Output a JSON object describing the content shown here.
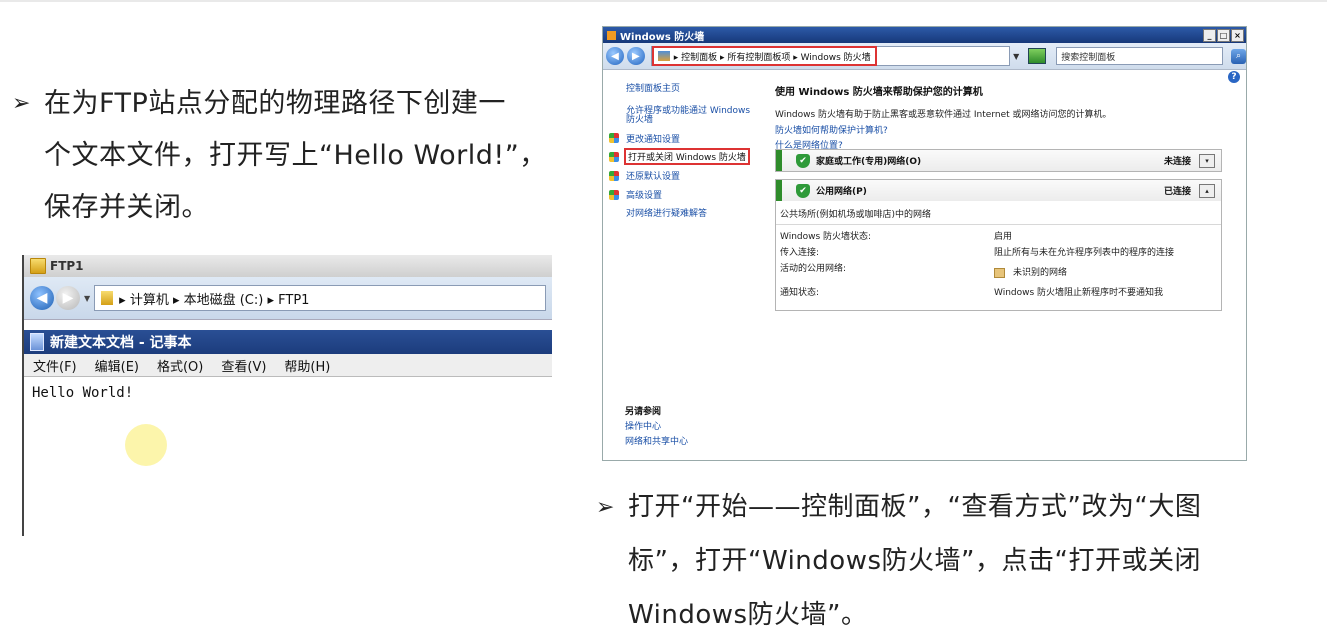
{
  "left_instruction": {
    "bullet": "➢",
    "line1": "在为FTP站点分配的物理路径下创建一",
    "line2": "个文本文件，打开写上“Hello World!”，",
    "line3": "保存并关闭。"
  },
  "explorer": {
    "title": "FTP1",
    "breadcrumb": "▸ 计算机 ▸ 本地磁盘 (C:) ▸ FTP1"
  },
  "notepad": {
    "title": "新建文本文档 - 记事本",
    "menu": [
      "文件(F)",
      "编辑(E)",
      "格式(O)",
      "查看(V)",
      "帮助(H)"
    ],
    "content": "Hello World!"
  },
  "firewall": {
    "window_title": "Windows 防火墙",
    "window_buttons": [
      "_",
      "□",
      "×"
    ],
    "address_path": "▸ 控制面板 ▸ 所有控制面板项 ▸ Windows 防火墙",
    "search_placeholder": "搜索控制面板",
    "left_nav": {
      "home": "控制面板主页",
      "allow_programs": "允许程序或功能通过 Windows 防火墙",
      "change_notify": "更改通知设置",
      "toggle_firewall": "打开或关闭 Windows 防火墙",
      "restore_defaults": "还原默认设置",
      "advanced": "高级设置",
      "troubleshoot": "对网络进行疑难解答"
    },
    "see_also": {
      "heading": "另请参阅",
      "action_center": "操作中心",
      "network_center": "网络和共享中心"
    },
    "main": {
      "title": "使用 Windows 防火墙来帮助保护您的计算机",
      "desc": "Windows 防火墙有助于防止黑客或恶意软件通过 Internet 或网络访问您的计算机。",
      "link1": "防火墙如何帮助保护计算机?",
      "link2": "什么是网络位置?"
    },
    "networks": [
      {
        "name": "家庭或工作(专用)网络(O)",
        "status": "未连接",
        "toggle": "▾"
      },
      {
        "name": "公用网络(P)",
        "status": "已连接",
        "toggle": "▴",
        "desc": "公共场所(例如机场或咖啡店)中的网络",
        "rows": [
          {
            "k": "Windows 防火墙状态:",
            "v": "启用"
          },
          {
            "k": "传入连接:",
            "v": "阻止所有与未在允许程序列表中的程序的连接"
          },
          {
            "k": "活动的公用网络:",
            "v": "未识别的网络"
          },
          {
            "k": "通知状态:",
            "v": "Windows 防火墙阻止新程序时不要通知我"
          }
        ]
      }
    ]
  },
  "right_instruction": {
    "bullet": "➢",
    "line1": "打开“开始——控制面板”，“查看方式”改为“大图",
    "line2": "标”，打开“Windows防火墙”，点击“打开或关闭",
    "line3": "Windows防火墙”。"
  }
}
